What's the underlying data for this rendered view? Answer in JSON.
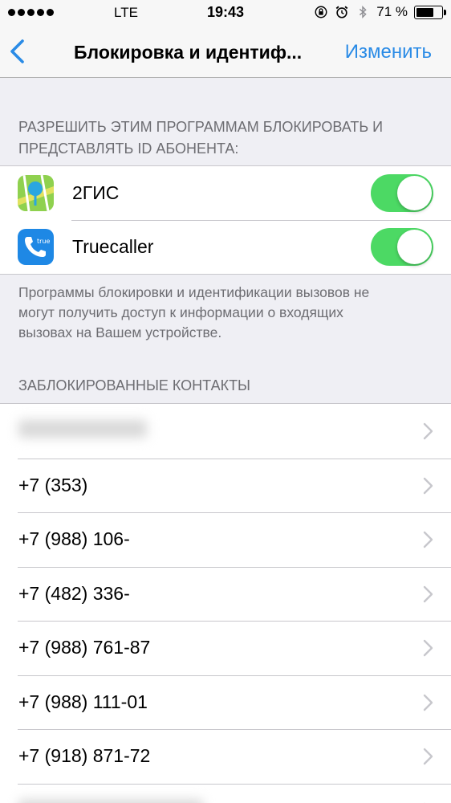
{
  "status_bar": {
    "carrier": "LTE",
    "time": "19:43",
    "battery_percent": "71 %",
    "battery_level": 0.71,
    "icons": [
      "signal-dots-icon",
      "orientation-lock-icon",
      "alarm-icon",
      "bluetooth-icon",
      "battery-icon"
    ]
  },
  "nav": {
    "back_icon": "chevron-left-icon",
    "title": "Блокировка и идентиф...",
    "edit_label": "Изменить",
    "accent_color": "#2a8be6"
  },
  "apps_section": {
    "header_line1": "РАЗРЕШИТЬ ЭТИМ ПРОГРАММАМ БЛОКИРОВАТЬ И",
    "header_line2": "ПРЕДСТАВЛЯТЬ ID АБОНЕНТА:",
    "items": [
      {
        "label": "2ГИС",
        "enabled": true,
        "icon": "2gis-app-icon"
      },
      {
        "label": "Truecaller",
        "enabled": true,
        "icon": "truecaller-app-icon",
        "icon_text": "true"
      }
    ],
    "toggle_on_color": "#4cd964",
    "footer_line1": "Программы блокировки и идентификации вызовов не",
    "footer_line2": "могут получить доступ к информации о входящих",
    "footer_line3": "вызовах на Вашем устройстве."
  },
  "blocked_section": {
    "header": "ЗАБЛОКИРОВАННЫЕ КОНТАКТЫ",
    "contacts": [
      {
        "label": ""
      },
      {
        "label": "+7 (353)"
      },
      {
        "label": "+7 (988) 106-"
      },
      {
        "label": "+7 (482) 336-"
      },
      {
        "label": "+7 (988) 761-87"
      },
      {
        "label": "+7 (988) 111-01"
      },
      {
        "label": "+7 (918) 871-72"
      },
      {
        "label": ""
      }
    ]
  }
}
